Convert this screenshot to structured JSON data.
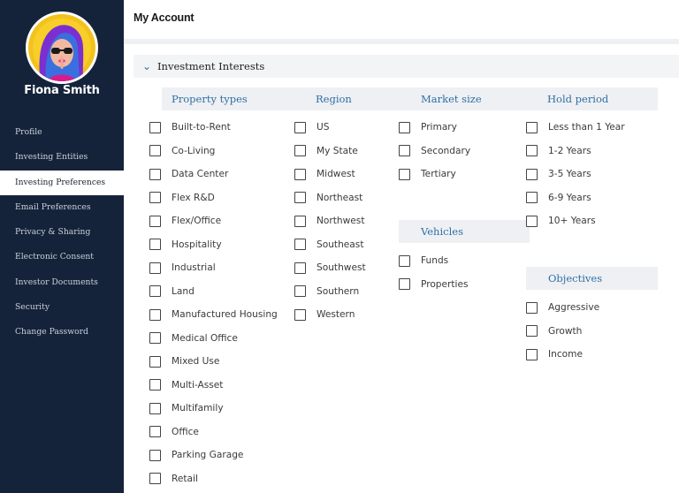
{
  "sidebar": {
    "user_name": "Fiona Smith",
    "items": [
      {
        "label": "Profile",
        "active": false
      },
      {
        "label": "Investing Entities",
        "active": false
      },
      {
        "label": "Investing Preferences",
        "active": true
      },
      {
        "label": "Email Preferences",
        "active": false
      },
      {
        "label": "Privacy & Sharing",
        "active": false
      },
      {
        "label": "Electronic Consent",
        "active": false
      },
      {
        "label": "Investor Documents",
        "active": false
      },
      {
        "label": "Security",
        "active": false
      },
      {
        "label": "Change Password",
        "active": false
      }
    ]
  },
  "header": {
    "title": "My Account"
  },
  "panel": {
    "title": "Investment Interests"
  },
  "groups": {
    "property_types": {
      "title": "Property types",
      "items": [
        "Built-to-Rent",
        "Co-Living",
        "Data Center",
        "Flex R&D",
        "Flex/Office",
        "Hospitality",
        "Industrial",
        "Land",
        "Manufactured Housing",
        "Medical Office",
        "Mixed Use",
        "Multi-Asset",
        "Multifamily",
        "Office",
        "Parking Garage",
        "Retail"
      ]
    },
    "region": {
      "title": "Region",
      "items": [
        "US",
        "My State",
        "Midwest",
        "Northeast",
        "Northwest",
        "Southeast",
        "Southwest",
        "Southern",
        "Western"
      ]
    },
    "market_size": {
      "title": "Market size",
      "items": [
        "Primary",
        "Secondary",
        "Tertiary"
      ]
    },
    "vehicles": {
      "title": "Vehicles",
      "items": [
        "Funds",
        "Properties"
      ]
    },
    "hold_period": {
      "title": "Hold period",
      "items": [
        "Less than 1 Year",
        "1-2 Years",
        "3-5 Years",
        "6-9 Years",
        "10+ Years"
      ]
    },
    "objectives": {
      "title": "Objectives",
      "items": [
        "Aggressive",
        "Growth",
        "Income"
      ]
    }
  },
  "colors": {
    "sidebar_bg": "#15233a",
    "accent": "#2f6fa5",
    "section_bg": "#eef0f3"
  },
  "icons": {
    "panel_toggle": "chevron-down-icon"
  }
}
